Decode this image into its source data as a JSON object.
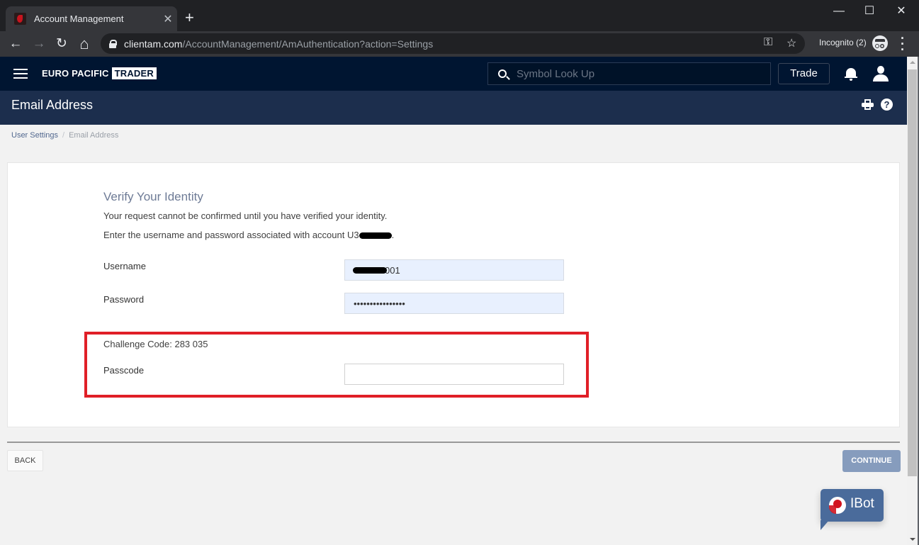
{
  "browser": {
    "tab_title": "Account Management",
    "tab_close": "✕",
    "new_tab": "+",
    "window_controls": {
      "minimize": "—",
      "maximize": "☐",
      "close": "✕"
    },
    "nav": {
      "back": "←",
      "forward": "→",
      "reload": "↻",
      "home": "⌂"
    },
    "url_host": "clientam.com",
    "url_path": "/AccountManagement/AmAuthentication?action=Settings",
    "key_icon": "⚿",
    "star_icon": "☆",
    "incognito_label": "Incognito (2)",
    "menu": "⋮"
  },
  "topnav": {
    "brand_primary": "EURO PACIFIC",
    "brand_secondary": "TRADER",
    "search_placeholder": "Symbol Look Up",
    "trade_label": "Trade"
  },
  "page_header": {
    "title": "Email Address",
    "help_glyph": "?"
  },
  "breadcrumb": {
    "items": [
      {
        "label": "User Settings"
      },
      {
        "label": "Email Address"
      }
    ],
    "separator": "/"
  },
  "form": {
    "title": "Verify Your Identity",
    "line1": "Your request cannot be confirmed until you have verified your identity.",
    "line2_prefix": "Enter the username and password associated with account U3",
    "line2_suffix": ".",
    "username_label": "Username",
    "username_value": "001",
    "password_label": "Password",
    "password_value": "••••••••••••••••",
    "challenge_label": "Challenge Code: 283 035",
    "passcode_label": "Passcode",
    "passcode_value": ""
  },
  "actions": {
    "back_label": "BACK",
    "continue_label": "CONTINUE"
  },
  "ibot": {
    "label": "IBot"
  },
  "colors": {
    "nav_bg": "#001531",
    "header_bg": "#1c2e4d",
    "highlight": "#e01f27",
    "continue_bg": "#869cbd",
    "ibot_bg": "#4a6b9b"
  }
}
